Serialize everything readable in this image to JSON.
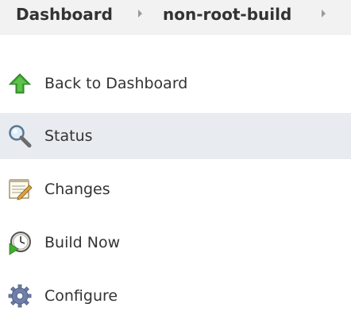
{
  "breadcrumb": {
    "items": [
      {
        "label": "Dashboard"
      },
      {
        "label": "non-root-build"
      }
    ]
  },
  "tasks": [
    {
      "label": "Back to Dashboard",
      "icon": "up-arrow-icon"
    },
    {
      "label": "Status",
      "icon": "magnifier-icon",
      "active": true
    },
    {
      "label": "Changes",
      "icon": "notepad-icon"
    },
    {
      "label": "Build Now",
      "icon": "clock-play-icon"
    },
    {
      "label": "Configure",
      "icon": "gear-icon"
    }
  ],
  "colors": {
    "breadcrumb_bg": "#f2f2f2",
    "active_task_bg": "#e8ebef",
    "text": "#333333"
  }
}
